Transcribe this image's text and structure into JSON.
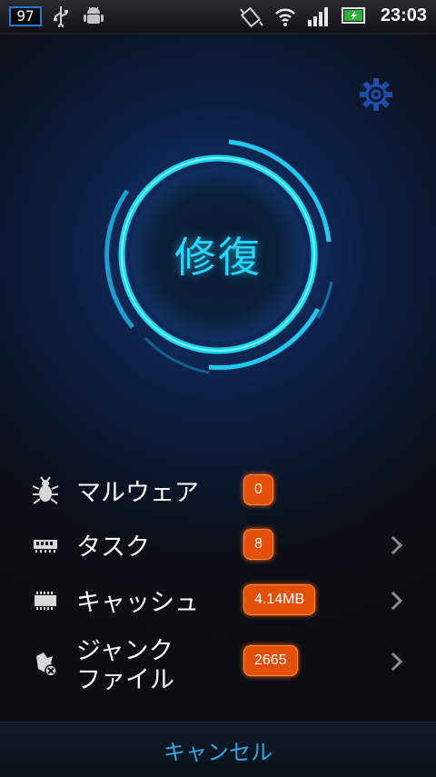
{
  "status_bar": {
    "battery_level": "97",
    "time": "23:03",
    "icons": [
      "usb-icon",
      "android-debug-icon",
      "vibrate-icon",
      "wifi-icon",
      "signal-icon",
      "battery-charging-icon"
    ]
  },
  "main": {
    "action_label": "修復",
    "settings_icon": "gear-icon"
  },
  "items": [
    {
      "icon": "bug-icon",
      "label": "マルウェア",
      "value": "0",
      "has_chevron": false
    },
    {
      "icon": "memory-icon",
      "label": "タスク",
      "value": "8",
      "has_chevron": true
    },
    {
      "icon": "chip-icon",
      "label": "キャッシュ",
      "value": "4.14MB",
      "has_chevron": true
    },
    {
      "icon": "junk-files-icon",
      "label_line1": "ジャンク",
      "label_line2": "ファイル",
      "value": "2665",
      "has_chevron": true
    }
  ],
  "footer": {
    "cancel_label": "キャンセル"
  },
  "colors": {
    "accent_cyan": "#26d7ff",
    "badge_orange": "#e4500a",
    "cancel_blue": "#2aa8e8"
  }
}
